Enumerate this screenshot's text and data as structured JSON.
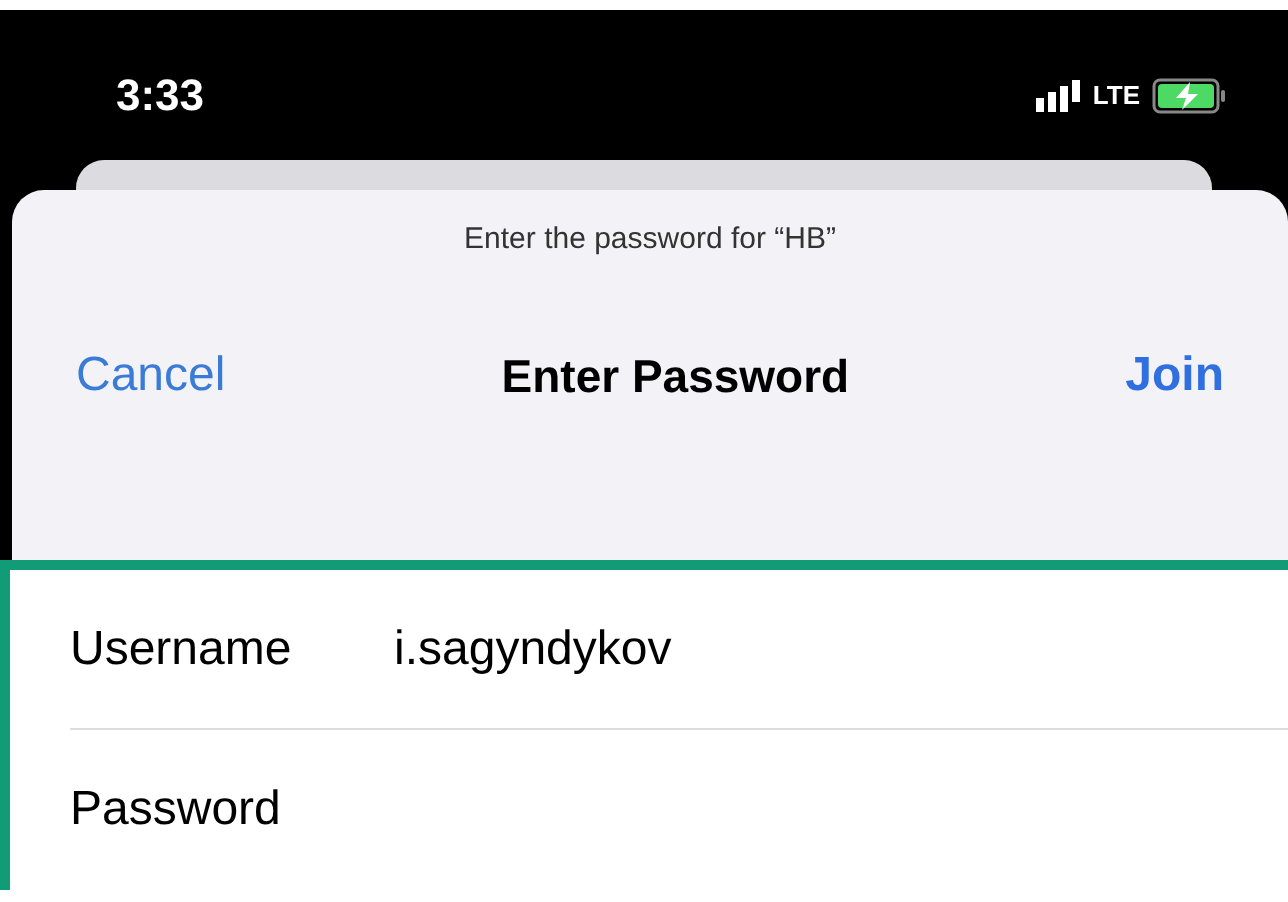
{
  "status_bar": {
    "time": "3:33",
    "network": "LTE",
    "charging": true
  },
  "sheet": {
    "prompt": "Enter the password for “HB”",
    "title": "Enter Password",
    "cancel": "Cancel",
    "join": "Join"
  },
  "form": {
    "highlighted": true,
    "fields": [
      {
        "label": "Username",
        "value": "i.sagyndykov"
      },
      {
        "label": "Password"
      }
    ]
  }
}
